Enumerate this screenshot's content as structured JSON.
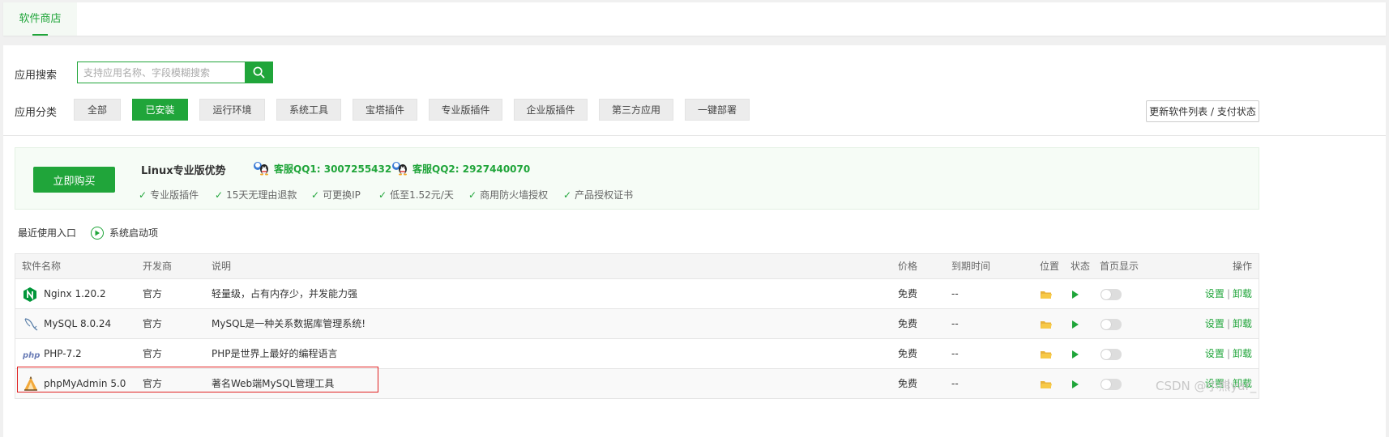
{
  "tabs": {
    "active": "软件商店"
  },
  "search": {
    "label": "应用搜索",
    "placeholder": "支持应用名称、字段模糊搜索"
  },
  "categories": {
    "label": "应用分类",
    "items": [
      "全部",
      "已安装",
      "运行环境",
      "系统工具",
      "宝塔插件",
      "专业版插件",
      "企业版插件",
      "第三方应用",
      "一键部署"
    ],
    "active_index": 1
  },
  "refresh_label": "更新软件列表 / 支付状态",
  "promo": {
    "buy_label": "立即购买",
    "title": "Linux专业版优势",
    "qq1": "客服QQ1: 3007255432",
    "qq2": "客服QQ2: 2927440070",
    "features": [
      "专业版插件",
      "15天无理由退款",
      "可更换IP",
      "低至1.52元/天",
      "商用防火墙授权",
      "产品授权证书"
    ]
  },
  "shortcuts": {
    "recent": "最近使用入口",
    "startup": "系统启动项"
  },
  "table": {
    "headers": {
      "name": "软件名称",
      "dev": "开发商",
      "desc": "说明",
      "price": "价格",
      "expire": "到期时间",
      "location": "位置",
      "status": "状态",
      "homepage": "首页显示",
      "ops": "操作"
    },
    "rows": [
      {
        "icon": "nginx-icon",
        "name": "Nginx 1.20.2",
        "dev": "官方",
        "desc": "轻量级，占有内存少，并发能力强",
        "price": "免费",
        "expire": "--",
        "op1": "设置",
        "op2": "卸载"
      },
      {
        "icon": "mysql-icon",
        "name": "MySQL 8.0.24",
        "dev": "官方",
        "desc": "MySQL是一种关系数据库管理系统!",
        "price": "免费",
        "expire": "--",
        "op1": "设置",
        "op2": "卸载"
      },
      {
        "icon": "php-icon",
        "name": "PHP-7.2",
        "dev": "官方",
        "desc": "PHP是世界上最好的编程语言",
        "price": "免费",
        "expire": "--",
        "op1": "设置",
        "op2": "卸载"
      },
      {
        "icon": "phpmyadmin-icon",
        "name": "phpMyAdmin 5.0",
        "dev": "官方",
        "desc": "著名Web端MySQL管理工具",
        "price": "免费",
        "expire": "--",
        "op1": "设置",
        "op2": "卸载"
      }
    ]
  },
  "watermark": "CSDN @小熊yar_",
  "colors": {
    "accent": "#20a53a",
    "highlight": "#e02020"
  }
}
